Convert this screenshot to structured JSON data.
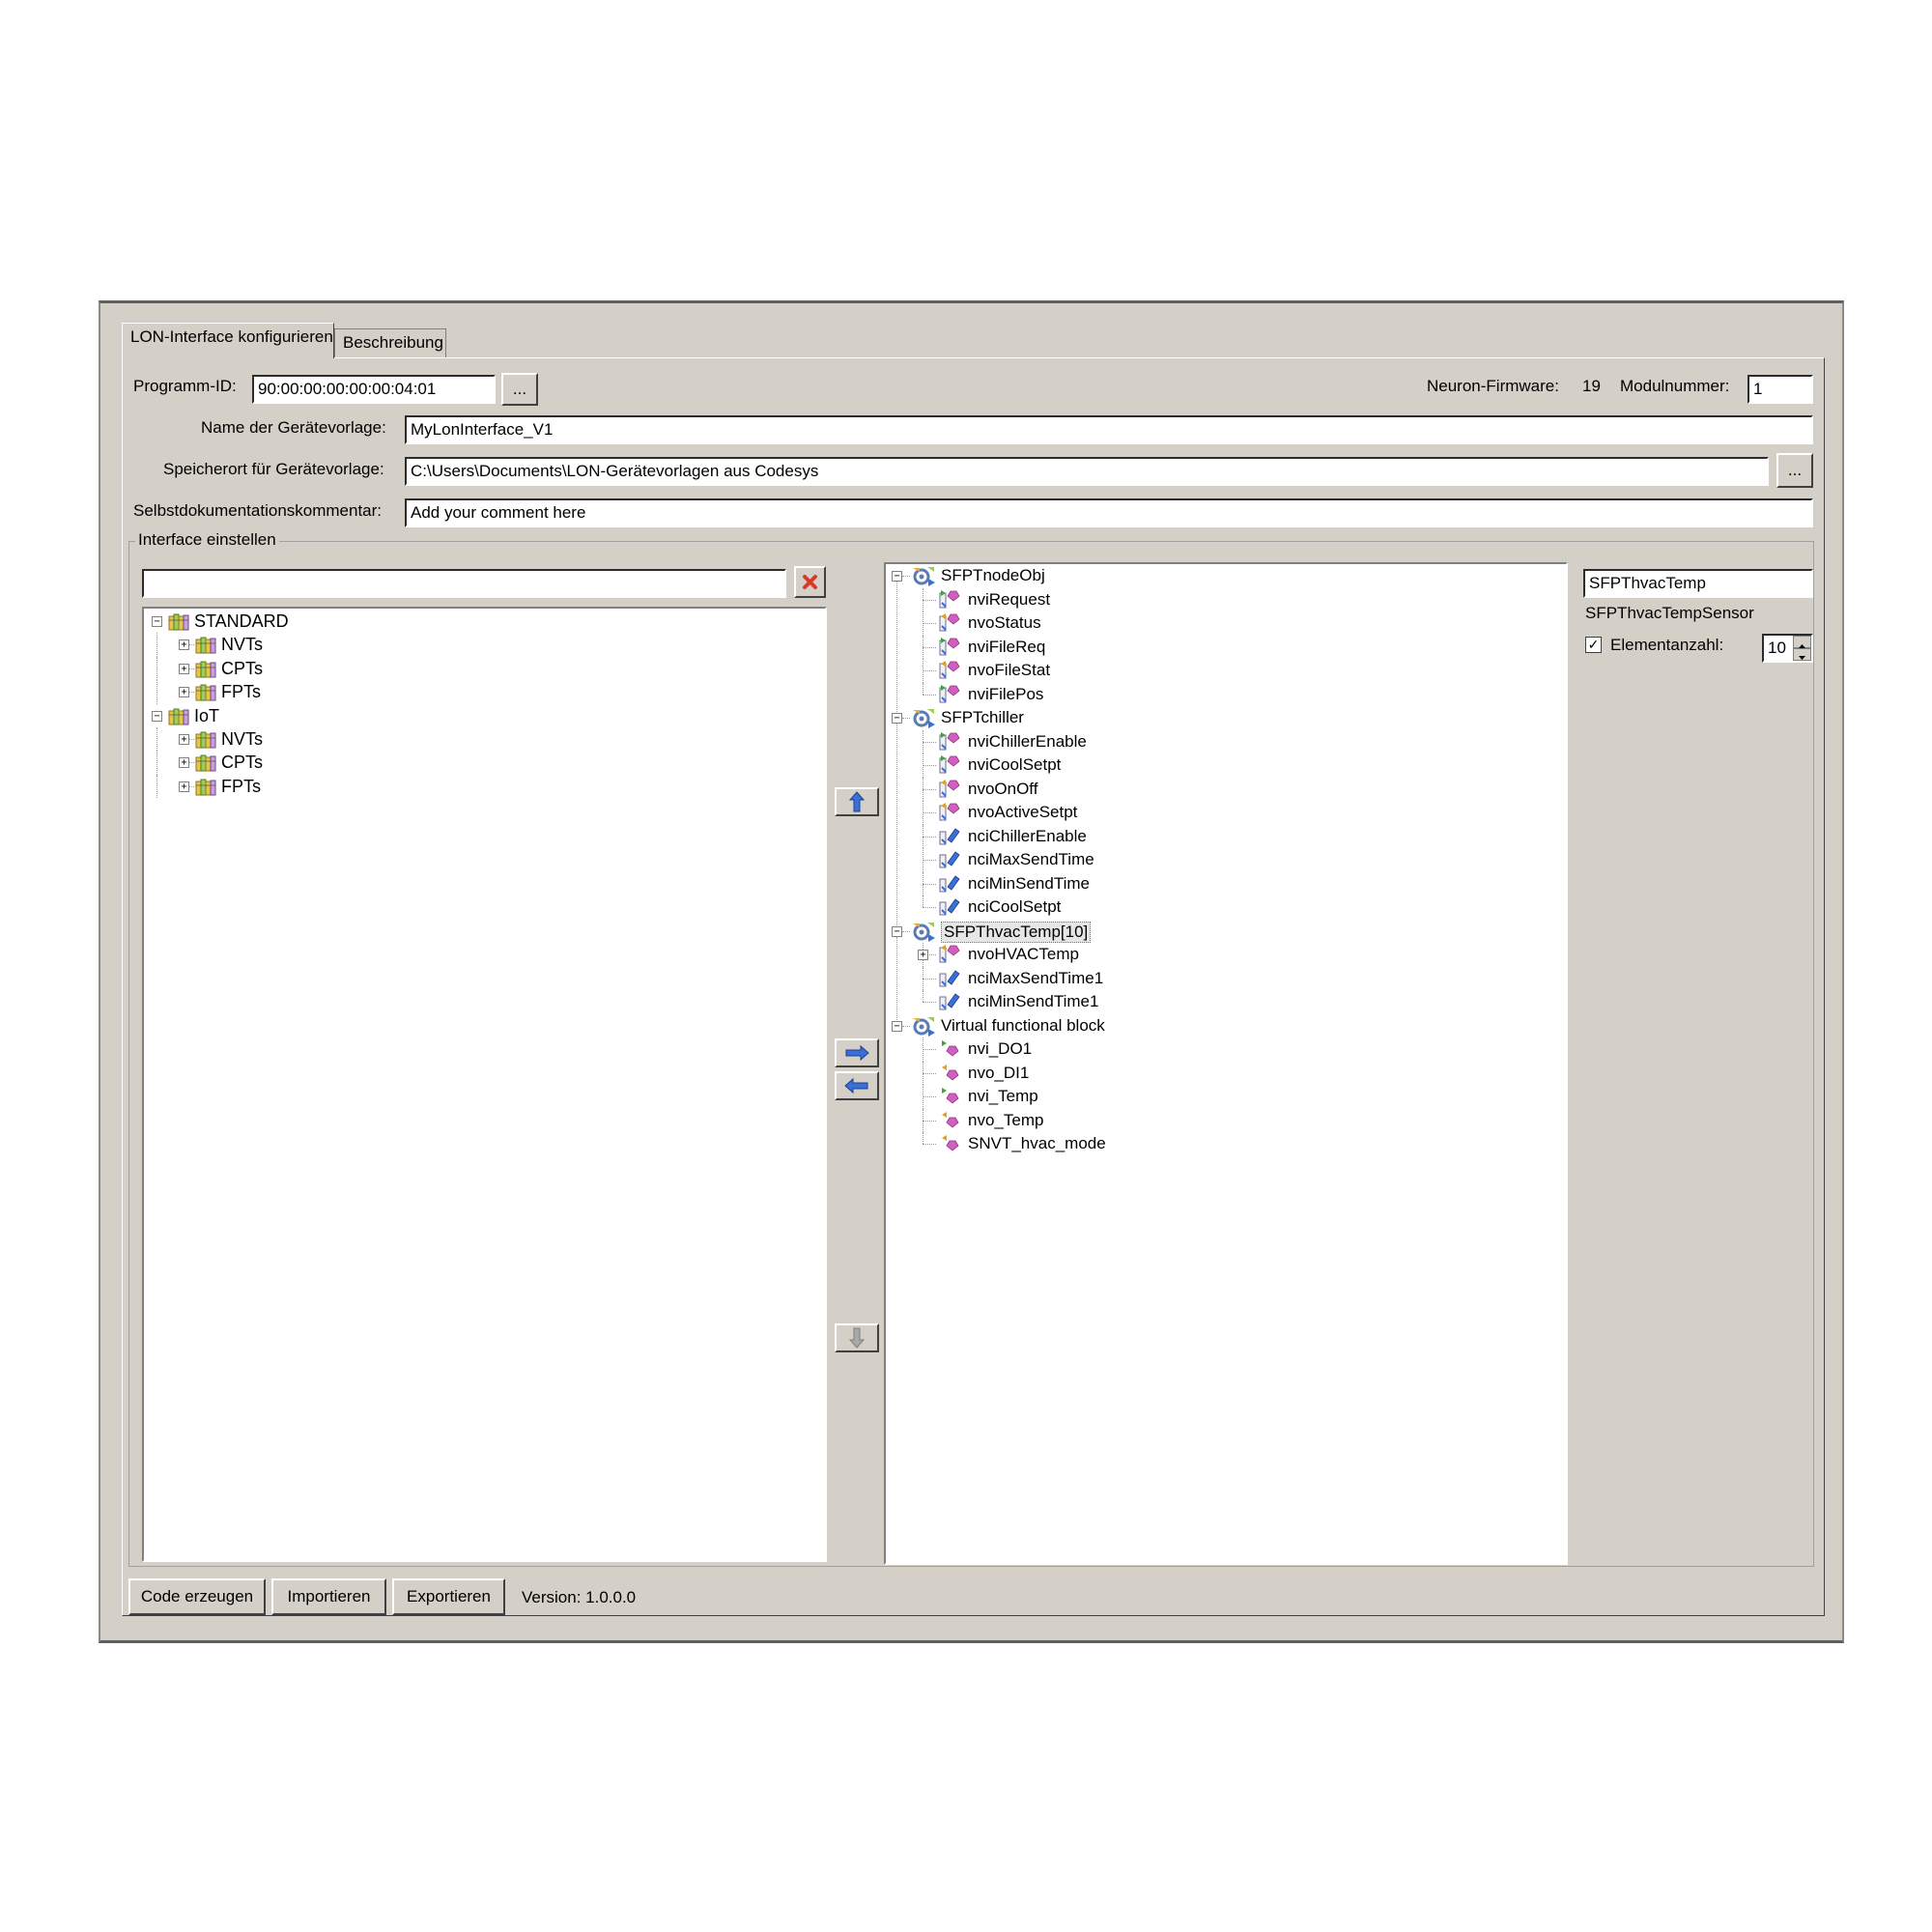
{
  "tabs": [
    {
      "label": "LON-Interface konfigurieren",
      "active": true
    },
    {
      "label": "Beschreibung",
      "active": false
    }
  ],
  "header": {
    "programm_id_label": "Programm-ID:",
    "programm_id_value": "90:00:00:00:00:00:04:01",
    "browse_label": "...",
    "neuron_label": "Neuron-Firmware:",
    "neuron_value": "19",
    "modul_label": "Modulnummer:",
    "modul_value": "1",
    "name_label": "Name der Gerätevorlage:",
    "name_value": "MyLonInterface_V1",
    "speicherort_label": "Speicherort für Gerätevorlage:",
    "speicherort_value": "C:\\Users\\Documents\\LON-Gerätevorlagen aus Codesys",
    "kommentar_label": "Selbstdokumentationskommentar:",
    "kommentar_value": "Add your comment here"
  },
  "interface": {
    "group_title": "Interface einstellen",
    "search_value": "",
    "library_tree": [
      {
        "label": "STANDARD",
        "level": 0,
        "expander": "−"
      },
      {
        "label": "NVTs",
        "level": 1,
        "expander": "+"
      },
      {
        "label": "CPTs",
        "level": 1,
        "expander": "+"
      },
      {
        "label": "FPTs",
        "level": 1,
        "expander": "+"
      },
      {
        "label": "IoT",
        "level": 0,
        "expander": "−"
      },
      {
        "label": "NVTs",
        "level": 1,
        "expander": "+"
      },
      {
        "label": "CPTs",
        "level": 1,
        "expander": "+"
      },
      {
        "label": "FPTs",
        "level": 1,
        "expander": "+"
      }
    ],
    "device_tree": [
      {
        "label": "SFPTnodeObj",
        "kind": "block",
        "expander": "−"
      },
      {
        "label": "nviRequest",
        "kind": "nv-in",
        "last": false
      },
      {
        "label": "nvoStatus",
        "kind": "nv-out",
        "last": false
      },
      {
        "label": "nviFileReq",
        "kind": "nv-in",
        "last": false
      },
      {
        "label": "nvoFileStat",
        "kind": "nv-out",
        "last": false
      },
      {
        "label": "nviFilePos",
        "kind": "nv-in",
        "last": true
      },
      {
        "label": "SFPTchiller",
        "kind": "block",
        "expander": "−"
      },
      {
        "label": "nviChillerEnable",
        "kind": "nv-in",
        "last": false
      },
      {
        "label": "nviCoolSetpt",
        "kind": "nv-in",
        "last": false
      },
      {
        "label": "nvoOnOff",
        "kind": "nv-out",
        "last": false
      },
      {
        "label": "nvoActiveSetpt",
        "kind": "nv-out",
        "last": false
      },
      {
        "label": "nciChillerEnable",
        "kind": "nci",
        "last": false
      },
      {
        "label": "nciMaxSendTime",
        "kind": "nci",
        "last": false
      },
      {
        "label": "nciMinSendTime",
        "kind": "nci",
        "last": false
      },
      {
        "label": "nciCoolSetpt",
        "kind": "nci",
        "last": true
      },
      {
        "label": "SFPThvacTemp[10]",
        "kind": "block",
        "expander": "−",
        "selected": true
      },
      {
        "label": "nvoHVACTemp",
        "kind": "nv-out",
        "last": false,
        "expander": "+"
      },
      {
        "label": "nciMaxSendTime1",
        "kind": "nci",
        "last": false
      },
      {
        "label": "nciMinSendTime1",
        "kind": "nci",
        "last": true
      },
      {
        "label": "Virtual functional block",
        "kind": "block",
        "expander": "−"
      },
      {
        "label": "nvi_DO1",
        "kind": "v-in",
        "last": false
      },
      {
        "label": "nvo_DI1",
        "kind": "v-out",
        "last": false
      },
      {
        "label": "nvi_Temp",
        "kind": "v-in",
        "last": false
      },
      {
        "label": "nvo_Temp",
        "kind": "v-out",
        "last": false
      },
      {
        "label": "SNVT_hvac_mode",
        "kind": "v-out",
        "last": true
      }
    ],
    "properties": {
      "name_value": "SFPThvacTemp",
      "type_label": "SFPThvacTempSensor",
      "element_label": "Elementanzahl:",
      "element_checked": "✓",
      "element_value": "10"
    }
  },
  "footer": {
    "code_label": "Code erzeugen",
    "import_label": "Importieren",
    "export_label": "Exportieren",
    "version_label": "Version: 1.0.0.0"
  },
  "colors": {
    "window_bg": "#d4d0c8",
    "accent_blue": "#3a6fd8",
    "clear_red": "#d83a2a"
  }
}
